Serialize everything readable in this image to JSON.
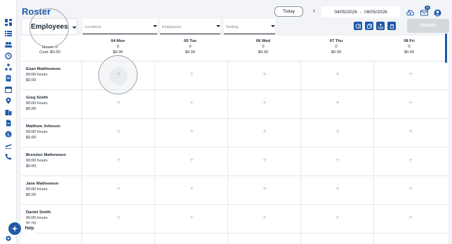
{
  "header": {
    "title": "Roster",
    "today_label": "Today",
    "date_from": "04/05/2026",
    "date_sep": "-",
    "date_to": "08/05/2026",
    "mail_badge": "10",
    "prev_icon": "chevron-left-icon",
    "next_icon": "chevron-right-icon"
  },
  "filters": {
    "view": "Employees",
    "locations_placeholder": "Locations",
    "employees_placeholder": "Employees",
    "sorting_placeholder": "Sorting",
    "publish_label": "Publish"
  },
  "summary": {
    "hours": "Hours: 0",
    "cost": "Cost: $0.00"
  },
  "days": [
    {
      "label": "04 Mon",
      "count": "0",
      "cost": "$0.00"
    },
    {
      "label": "05 Tue",
      "count": "0",
      "cost": "$0.00"
    },
    {
      "label": "06 Wed",
      "count": "0",
      "cost": "$0.00"
    },
    {
      "label": "07 Thu",
      "count": "0",
      "cost": "$0.00"
    },
    {
      "label": "08 Fri",
      "count": "0",
      "cost": "$0.00"
    }
  ],
  "employees": [
    {
      "name": "Euan Matthewson",
      "hours": "00:00 hours",
      "cost": "$0.00"
    },
    {
      "name": "Greg Smith",
      "hours": "00:00 hours",
      "cost": "$0.00"
    },
    {
      "name": "Matthew Johnson",
      "hours": "00:00 hours",
      "cost": "$0.00"
    },
    {
      "name": "Brendon Mathewson",
      "hours": "00:00 hours",
      "cost": "$0.00"
    },
    {
      "name": "Jane Mathewson",
      "hours": "00:00 hours",
      "cost": "$0.00"
    },
    {
      "name": "Daniel Smith",
      "hours": "00:00 hours",
      "cost": "$0.00"
    }
  ],
  "add_shift_symbol": "+",
  "help_label": "Help",
  "colors": {
    "accent": "#1e5aa8",
    "publish_disabled": "#d5d9de"
  }
}
